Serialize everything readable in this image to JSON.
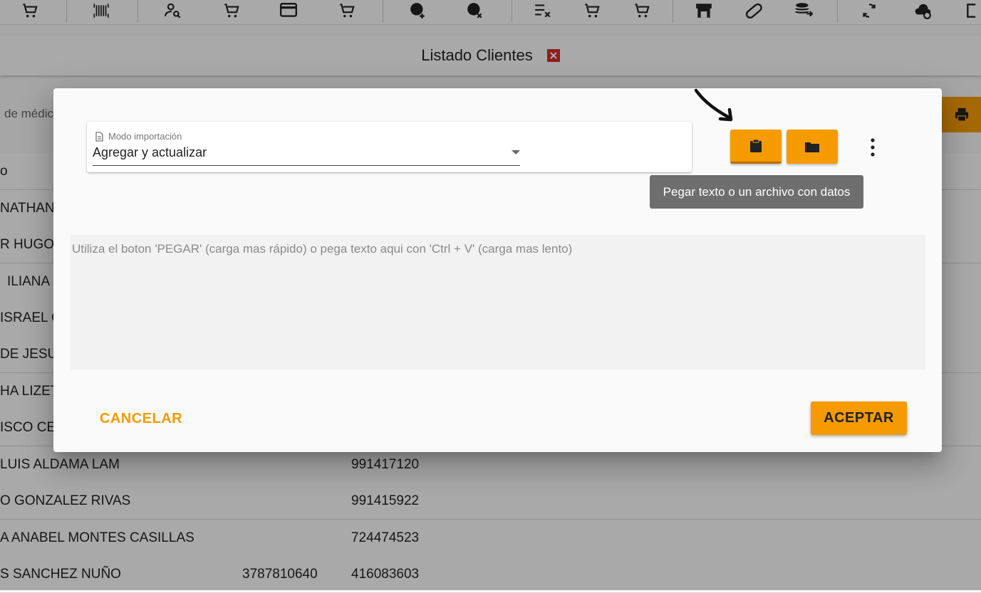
{
  "toolbar": {
    "icons": [
      "cart-icon",
      "barcode-icon",
      "user-search-icon",
      "cart-icon",
      "card-icon",
      "cart-icon",
      "clock-add-icon",
      "clock-cancel-icon",
      "list-remove-icon",
      "cart-icon",
      "cart-icon",
      "store-icon",
      "pill-icon",
      "database-icon",
      "sync-icon",
      "cloud-sync-icon",
      "logout-icon"
    ]
  },
  "header": {
    "title": "Listado Clientes"
  },
  "search": {
    "placeholder": "de médic"
  },
  "table": {
    "header_fragment": "o",
    "rows": [
      {
        "name": "NATHANA",
        "phone": "",
        "id": ""
      },
      {
        "name": "R HUGO S",
        "phone": "",
        "id": ""
      },
      {
        "name": "ILIANA",
        "phone": "",
        "id": ""
      },
      {
        "name": "ISRAEL CA",
        "phone": "",
        "id": ""
      },
      {
        "name": "DE JESUS",
        "phone": "",
        "id": ""
      },
      {
        "name": "HA LIZET",
        "phone": "",
        "id": ""
      },
      {
        "name": "ISCO CER",
        "phone": "",
        "id": ""
      },
      {
        "name": "LUIS ALDAMA LAM",
        "phone": "",
        "id": "991417120"
      },
      {
        "name": "O GONZALEZ RIVAS",
        "phone": "",
        "id": "991415922"
      },
      {
        "name": "A ANABEL MONTES CASILLAS",
        "phone": "",
        "id": "724474523"
      },
      {
        "name": "S SANCHEZ NUÑO",
        "phone": "3787810640",
        "id": "416083603"
      }
    ]
  },
  "dialog": {
    "mode_label": "Modo importación",
    "mode_value": "Agregar y actualizar",
    "tooltip": "Pegar texto o un archivo con datos",
    "textarea_placeholder": "Utiliza el boton 'PEGAR' (carga mas rápido) o pega texto aqui con 'Ctrl + V' (carga mas lento)",
    "cancel_label": "CANCELAR",
    "accept_label": "ACEPTAR"
  },
  "colors": {
    "accent": "#f59b00",
    "close_red": "#d32f2f",
    "tooltip_bg": "#6e6e6e"
  }
}
